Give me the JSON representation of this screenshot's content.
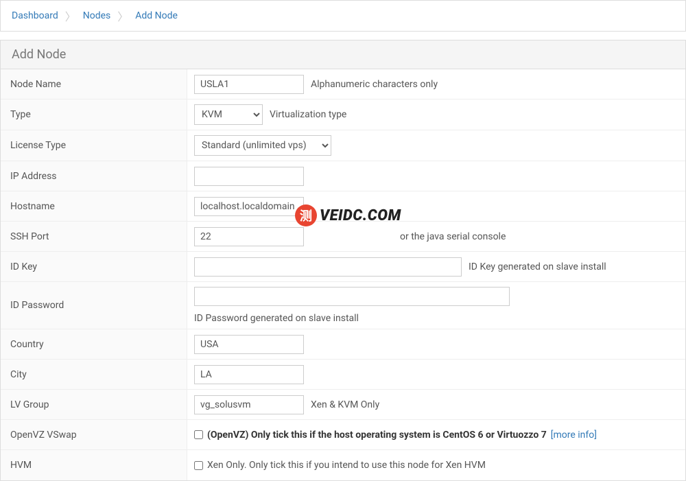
{
  "breadcrumb": {
    "items": [
      "Dashboard",
      "Nodes",
      "Add Node"
    ]
  },
  "panel": {
    "title": "Add Node"
  },
  "form": {
    "nodeName": {
      "label": "Node Name",
      "value": "USLA1",
      "help": "Alphanumeric characters only"
    },
    "type": {
      "label": "Type",
      "value": "KVM",
      "help": "Virtualization type"
    },
    "licenseType": {
      "label": "License Type",
      "value": "Standard (unlimited vps)"
    },
    "ipAddress": {
      "label": "IP Address",
      "value": ""
    },
    "hostname": {
      "label": "Hostname",
      "value": "localhost.localdomain"
    },
    "sshPort": {
      "label": "SSH Port",
      "value": "22",
      "help": "or the java serial console"
    },
    "idKey": {
      "label": "ID Key",
      "value": "",
      "help": "ID Key generated on slave install"
    },
    "idPassword": {
      "label": "ID Password",
      "value": "",
      "help": "ID Password generated on slave install"
    },
    "country": {
      "label": "Country",
      "value": "USA"
    },
    "city": {
      "label": "City",
      "value": "LA"
    },
    "lvGroup": {
      "label": "LV Group",
      "value": "vg_solusvm",
      "help": "Xen & KVM Only"
    },
    "openvzVswap": {
      "label": "OpenVZ VSwap",
      "desc": "(OpenVZ) Only tick this if the host operating system is CentOS 6 or Virtuozzo 7",
      "moreInfo": "[more info]"
    },
    "hvm": {
      "label": "HVM",
      "desc": "Xen Only. Only tick this if you intend to use this node for Xen HVM"
    }
  },
  "watermark": {
    "icon": "测",
    "text": "VEIDC.COM"
  }
}
